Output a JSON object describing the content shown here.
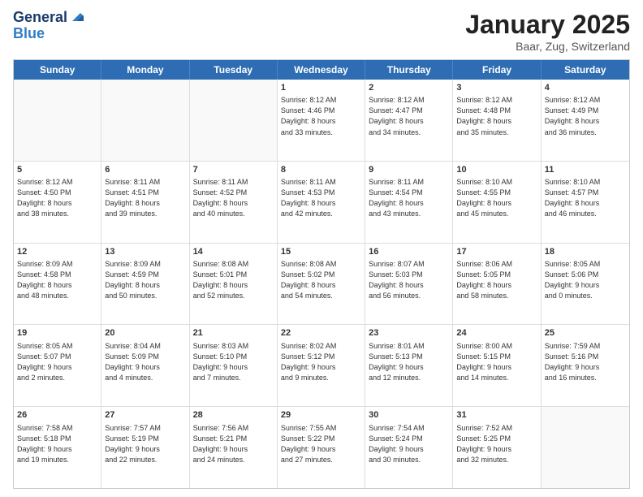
{
  "logo": {
    "general": "General",
    "blue": "Blue"
  },
  "title": {
    "month": "January 2025",
    "location": "Baar, Zug, Switzerland"
  },
  "weekdays": [
    "Sunday",
    "Monday",
    "Tuesday",
    "Wednesday",
    "Thursday",
    "Friday",
    "Saturday"
  ],
  "rows": [
    [
      {
        "day": "",
        "text": "",
        "empty": true
      },
      {
        "day": "",
        "text": "",
        "empty": true
      },
      {
        "day": "",
        "text": "",
        "empty": true
      },
      {
        "day": "1",
        "text": "Sunrise: 8:12 AM\nSunset: 4:46 PM\nDaylight: 8 hours\nand 33 minutes."
      },
      {
        "day": "2",
        "text": "Sunrise: 8:12 AM\nSunset: 4:47 PM\nDaylight: 8 hours\nand 34 minutes."
      },
      {
        "day": "3",
        "text": "Sunrise: 8:12 AM\nSunset: 4:48 PM\nDaylight: 8 hours\nand 35 minutes."
      },
      {
        "day": "4",
        "text": "Sunrise: 8:12 AM\nSunset: 4:49 PM\nDaylight: 8 hours\nand 36 minutes."
      }
    ],
    [
      {
        "day": "5",
        "text": "Sunrise: 8:12 AM\nSunset: 4:50 PM\nDaylight: 8 hours\nand 38 minutes."
      },
      {
        "day": "6",
        "text": "Sunrise: 8:11 AM\nSunset: 4:51 PM\nDaylight: 8 hours\nand 39 minutes."
      },
      {
        "day": "7",
        "text": "Sunrise: 8:11 AM\nSunset: 4:52 PM\nDaylight: 8 hours\nand 40 minutes."
      },
      {
        "day": "8",
        "text": "Sunrise: 8:11 AM\nSunset: 4:53 PM\nDaylight: 8 hours\nand 42 minutes."
      },
      {
        "day": "9",
        "text": "Sunrise: 8:11 AM\nSunset: 4:54 PM\nDaylight: 8 hours\nand 43 minutes."
      },
      {
        "day": "10",
        "text": "Sunrise: 8:10 AM\nSunset: 4:55 PM\nDaylight: 8 hours\nand 45 minutes."
      },
      {
        "day": "11",
        "text": "Sunrise: 8:10 AM\nSunset: 4:57 PM\nDaylight: 8 hours\nand 46 minutes."
      }
    ],
    [
      {
        "day": "12",
        "text": "Sunrise: 8:09 AM\nSunset: 4:58 PM\nDaylight: 8 hours\nand 48 minutes."
      },
      {
        "day": "13",
        "text": "Sunrise: 8:09 AM\nSunset: 4:59 PM\nDaylight: 8 hours\nand 50 minutes."
      },
      {
        "day": "14",
        "text": "Sunrise: 8:08 AM\nSunset: 5:01 PM\nDaylight: 8 hours\nand 52 minutes."
      },
      {
        "day": "15",
        "text": "Sunrise: 8:08 AM\nSunset: 5:02 PM\nDaylight: 8 hours\nand 54 minutes."
      },
      {
        "day": "16",
        "text": "Sunrise: 8:07 AM\nSunset: 5:03 PM\nDaylight: 8 hours\nand 56 minutes."
      },
      {
        "day": "17",
        "text": "Sunrise: 8:06 AM\nSunset: 5:05 PM\nDaylight: 8 hours\nand 58 minutes."
      },
      {
        "day": "18",
        "text": "Sunrise: 8:05 AM\nSunset: 5:06 PM\nDaylight: 9 hours\nand 0 minutes."
      }
    ],
    [
      {
        "day": "19",
        "text": "Sunrise: 8:05 AM\nSunset: 5:07 PM\nDaylight: 9 hours\nand 2 minutes."
      },
      {
        "day": "20",
        "text": "Sunrise: 8:04 AM\nSunset: 5:09 PM\nDaylight: 9 hours\nand 4 minutes."
      },
      {
        "day": "21",
        "text": "Sunrise: 8:03 AM\nSunset: 5:10 PM\nDaylight: 9 hours\nand 7 minutes."
      },
      {
        "day": "22",
        "text": "Sunrise: 8:02 AM\nSunset: 5:12 PM\nDaylight: 9 hours\nand 9 minutes."
      },
      {
        "day": "23",
        "text": "Sunrise: 8:01 AM\nSunset: 5:13 PM\nDaylight: 9 hours\nand 12 minutes."
      },
      {
        "day": "24",
        "text": "Sunrise: 8:00 AM\nSunset: 5:15 PM\nDaylight: 9 hours\nand 14 minutes."
      },
      {
        "day": "25",
        "text": "Sunrise: 7:59 AM\nSunset: 5:16 PM\nDaylight: 9 hours\nand 16 minutes."
      }
    ],
    [
      {
        "day": "26",
        "text": "Sunrise: 7:58 AM\nSunset: 5:18 PM\nDaylight: 9 hours\nand 19 minutes."
      },
      {
        "day": "27",
        "text": "Sunrise: 7:57 AM\nSunset: 5:19 PM\nDaylight: 9 hours\nand 22 minutes."
      },
      {
        "day": "28",
        "text": "Sunrise: 7:56 AM\nSunset: 5:21 PM\nDaylight: 9 hours\nand 24 minutes."
      },
      {
        "day": "29",
        "text": "Sunrise: 7:55 AM\nSunset: 5:22 PM\nDaylight: 9 hours\nand 27 minutes."
      },
      {
        "day": "30",
        "text": "Sunrise: 7:54 AM\nSunset: 5:24 PM\nDaylight: 9 hours\nand 30 minutes."
      },
      {
        "day": "31",
        "text": "Sunrise: 7:52 AM\nSunset: 5:25 PM\nDaylight: 9 hours\nand 32 minutes."
      },
      {
        "day": "",
        "text": "",
        "empty": true
      }
    ]
  ]
}
